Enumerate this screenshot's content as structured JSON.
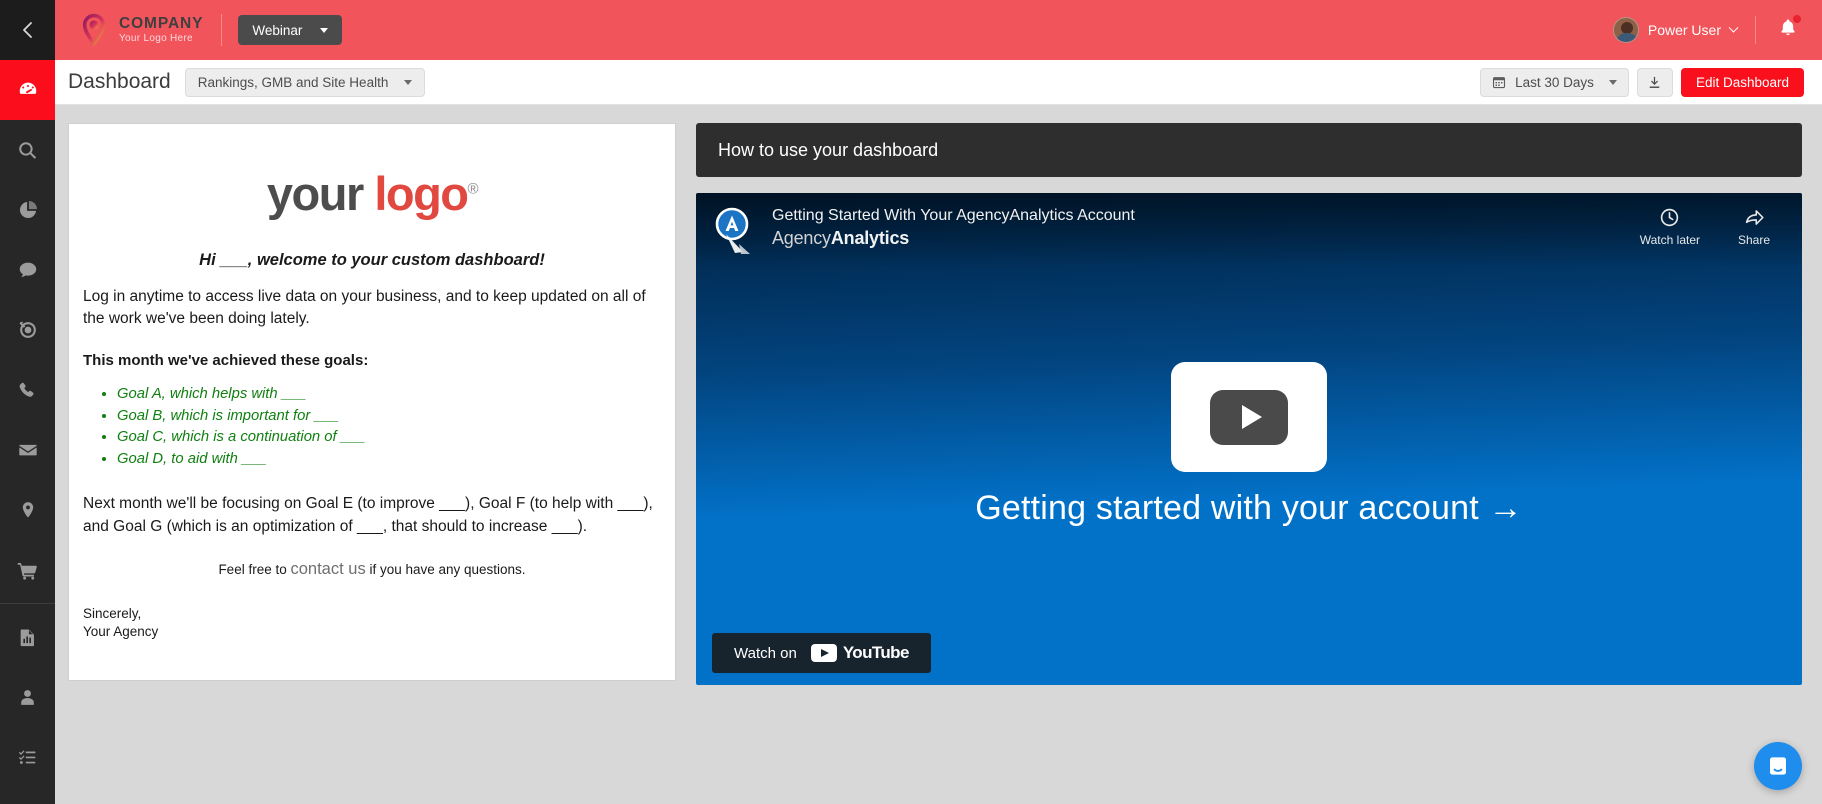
{
  "rail": {
    "collapse_icon": "chevron-left-icon",
    "items": [
      {
        "icon": "dashboard-gauge-icon",
        "label": "Dashboard",
        "active": true
      },
      {
        "icon": "search-icon",
        "label": "Search",
        "active": false
      },
      {
        "icon": "pie-chart-icon",
        "label": "Analytics",
        "active": false
      },
      {
        "icon": "chat-bubble-icon",
        "label": "Social",
        "active": false
      },
      {
        "icon": "target-icon",
        "label": "Goals",
        "active": false
      },
      {
        "icon": "phone-icon",
        "label": "Call Tracking",
        "active": false
      },
      {
        "icon": "envelope-icon",
        "label": "Email",
        "active": false
      },
      {
        "icon": "map-pin-icon",
        "label": "Local",
        "active": false
      },
      {
        "icon": "shopping-cart-icon",
        "label": "Ecommerce",
        "active": false
      },
      {
        "icon": "report-document-icon",
        "label": "Reports",
        "active": false
      },
      {
        "icon": "person-icon",
        "label": "Clients",
        "active": false
      },
      {
        "icon": "checklist-icon",
        "label": "Tasks",
        "active": false
      }
    ]
  },
  "topbar": {
    "brand_name": "COMPANY",
    "brand_sub": "Your Logo Here",
    "brand_icon": "company-logo-pin-icon",
    "webinar_label": "Webinar",
    "user_name": "Power User",
    "avatar_icon": "user-avatar",
    "bell_icon": "notification-bell-icon",
    "accent": "#f2545b"
  },
  "subheader": {
    "title": "Dashboard",
    "dashboard_select": "Rankings, GMB and Site Health",
    "date_range": "Last 30 Days",
    "calendar_icon": "calendar-icon",
    "download_icon": "download-icon",
    "edit_label": "Edit Dashboard",
    "edit_color": "#fa0f1d"
  },
  "letter": {
    "logo_part1": "your ",
    "logo_part2": "logo",
    "logo_reg": "®",
    "greeting": "Hi ___, welcome to your custom dashboard!",
    "intro": "Log in anytime to access live data on your business, and to keep updated on all of the work we've been doing lately.",
    "goals_heading": "This month we've achieved these goals:",
    "goals": [
      "Goal A, which helps with ___",
      "Goal B, which is important for ___",
      "Goal C, which is a continuation of ___",
      "Goal D, to aid with ___"
    ],
    "next_month": "Next month we'll be focusing on Goal E (to improve ___), Goal F (to help with ___), and Goal G (which is an optimization of ___, that should to increase ___).",
    "contact_prefix": "Feel free to ",
    "contact_link": "contact us",
    "contact_suffix": " if you have any questions.",
    "signoff_line1": "Sincerely,",
    "signoff_line2": "Your Agency",
    "goal_color": "#108010"
  },
  "video_panel": {
    "header": "How to use your dashboard",
    "video_title": "Getting Started With Your AgencyAnalytics Account",
    "channel_light": "Agency",
    "channel_bold": "Analytics",
    "channel_logo_icon": "agencyanalytics-logo-icon",
    "watch_later_label": "Watch later",
    "watch_later_icon": "clock-icon",
    "share_label": "Share",
    "share_icon": "share-arrow-icon",
    "play_icon": "youtube-play-button-icon",
    "tagline": "Getting started with your account →",
    "watch_on_label": "Watch on",
    "youtube_word": "YouTube",
    "youtube_icon": "youtube-logo-icon"
  },
  "intercom": {
    "icon": "intercom-chat-icon",
    "color": "#1f8ded"
  }
}
